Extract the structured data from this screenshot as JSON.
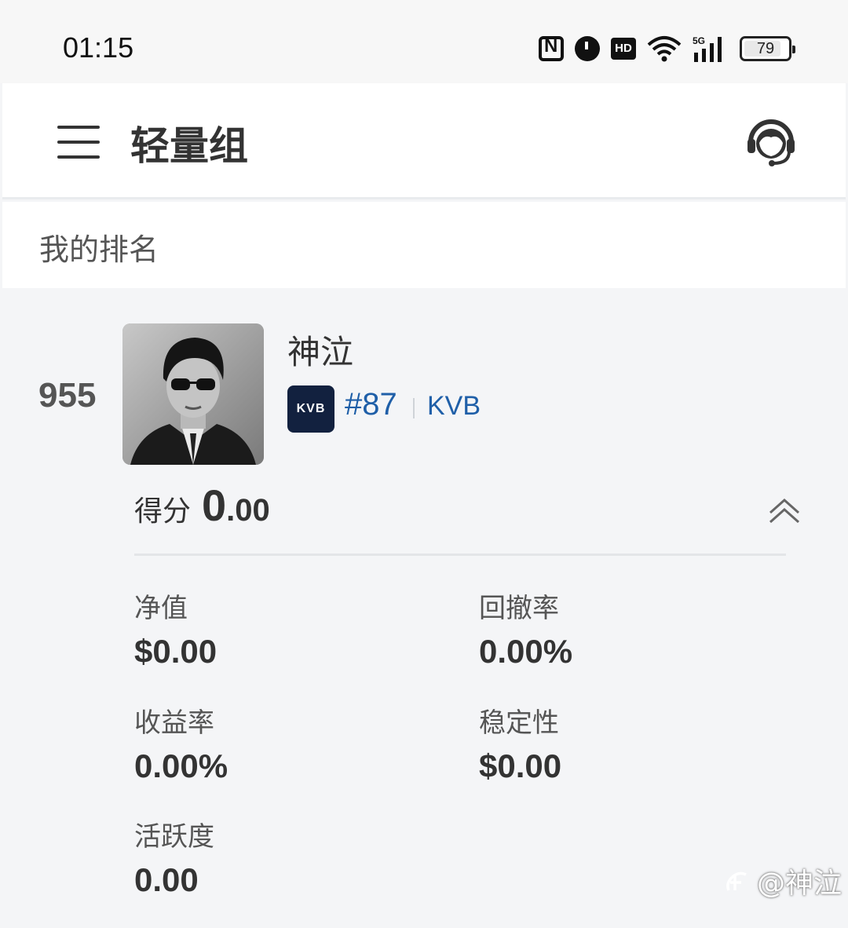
{
  "status_bar": {
    "time": "01:15",
    "battery_level": "79",
    "icons": [
      "nfc-icon",
      "alarm-icon",
      "hd-icon",
      "wifi-icon",
      "5g-signal-icon",
      "battery-icon"
    ]
  },
  "header": {
    "title": "轻量组",
    "menu_icon": "hamburger-menu-icon",
    "support_icon": "customer-support-headset-icon"
  },
  "section": {
    "label": "我的排名"
  },
  "ranking": {
    "rank": "955",
    "user_name": "神泣",
    "broker_logo_text": "KVB",
    "broker_rank": "#87",
    "broker_name": "KVB",
    "score_label": "得分",
    "score_int": "0",
    "score_dec": ".00",
    "metrics": [
      {
        "label": "净值",
        "value": "$0.00"
      },
      {
        "label": "回撤率",
        "value": "0.00%"
      },
      {
        "label": "收益率",
        "value": "0.00%"
      },
      {
        "label": "稳定性",
        "value": "$0.00"
      },
      {
        "label": "活跃度",
        "value": "0.00"
      }
    ]
  },
  "watermark": {
    "text": "@神泣"
  },
  "colors": {
    "brand_blue": "#1f5fa8",
    "logo_navy": "#12213f",
    "card_bg": "#f4f5f7"
  }
}
